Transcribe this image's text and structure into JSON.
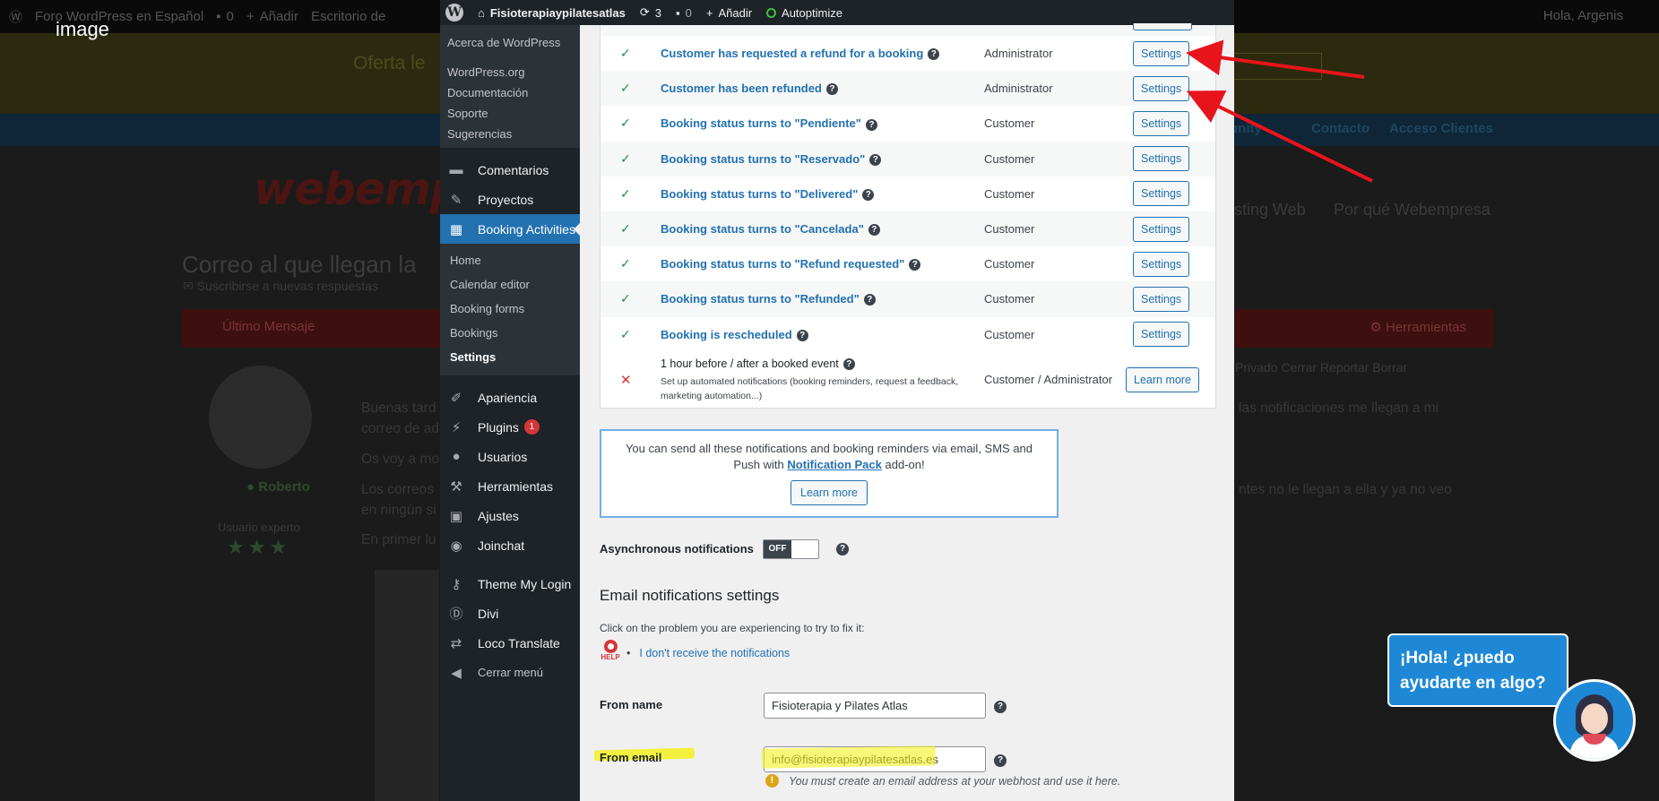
{
  "image_label": "image",
  "background": {
    "adminbar": {
      "site": "Foro WordPress en Español",
      "comments": "0",
      "add": "Añadir",
      "dashboard": "Escritorio de",
      "greeting": "Hola, Argenis"
    },
    "offer_text": "Oferta le",
    "nav": [
      "unity",
      "Contacto",
      "Acceso Clientes"
    ],
    "logo": "webempre",
    "menu": [
      "sting Web",
      "Por qué Webempresa"
    ],
    "title": "Correo al que llegan la",
    "subscribe": "Suscribirse a nuevas respuestas",
    "last_message": "Último Mensaje",
    "tools": "Herramientas",
    "post_actions": "Privado   Cerrar   Reportar   Borrar",
    "username": "Roberto",
    "user_role": "Usuario experto",
    "stars": "★★★",
    "post_lines": [
      "Buenas tard",
      "correo de ad",
      "Os voy a mo",
      "Los correos",
      "en ningún si",
      "En primer lu"
    ],
    "post_right_lines": [
      "las notificaciones me llegan a mi",
      "ntes no le llegan a ella y ya no veo"
    ]
  },
  "wp": {
    "topbar": {
      "site_name": "Fisioterapiaypilatesatlas",
      "updates": "3",
      "comments": "0",
      "add": "Añadir",
      "plugin": "Autoptimize"
    },
    "flyout": [
      "Acerca de WordPress",
      "WordPress.org",
      "Documentación",
      "Soporte",
      "Sugerencias"
    ],
    "menu_top": [
      {
        "label": "Comentarios",
        "icon": "comment-icon"
      },
      {
        "label": "Proyectos",
        "icon": "pin-icon"
      },
      {
        "label": "Booking Activities",
        "icon": "calendar-icon"
      }
    ],
    "submenu": [
      "Home",
      "Calendar editor",
      "Booking forms",
      "Bookings",
      "Settings"
    ],
    "menu_bottom": [
      {
        "label": "Apariencia",
        "icon": "brush-icon"
      },
      {
        "label": "Plugins",
        "icon": "plug-icon",
        "badge": "1"
      },
      {
        "label": "Usuarios",
        "icon": "user-icon"
      },
      {
        "label": "Herramientas",
        "icon": "wrench-icon"
      },
      {
        "label": "Ajustes",
        "icon": "settings-icon"
      },
      {
        "label": "Joinchat",
        "icon": "whatsapp-icon"
      }
    ],
    "menu_extra": [
      {
        "label": "Theme My Login",
        "icon": "key-icon"
      },
      {
        "label": "Divi",
        "icon": "divi-icon"
      },
      {
        "label": "Loco Translate",
        "icon": "translate-icon"
      },
      {
        "label": "Cerrar menú",
        "icon": "collapse-icon"
      }
    ],
    "notifications": [
      {
        "name": "Customer has requested a refund for a booking",
        "recipient": "Administrator",
        "action": "Settings"
      },
      {
        "name": "Customer has been refunded",
        "recipient": "Administrator",
        "action": "Settings"
      },
      {
        "name": "Booking status turns to \"Pendiente\"",
        "recipient": "Customer",
        "action": "Settings"
      },
      {
        "name": "Booking status turns to \"Reservado\"",
        "recipient": "Customer",
        "action": "Settings"
      },
      {
        "name": "Booking status turns to \"Delivered\"",
        "recipient": "Customer",
        "action": "Settings"
      },
      {
        "name": "Booking status turns to \"Cancelada\"",
        "recipient": "Customer",
        "action": "Settings"
      },
      {
        "name": "Booking status turns to \"Refund requested\"",
        "recipient": "Customer",
        "action": "Settings"
      },
      {
        "name": "Booking status turns to \"Refunded\"",
        "recipient": "Customer",
        "action": "Settings"
      },
      {
        "name": "Booking is rescheduled",
        "recipient": "Customer",
        "action": "Settings"
      }
    ],
    "cron_row": {
      "name": "1 hour before / after a booked event",
      "desc": "Set up automated notifications (booking reminders, request a feedback, marketing automation...)",
      "recipient": "Customer / Administrator",
      "action": "Learn more"
    },
    "pack_box": {
      "text_before": "You can send all these notifications and booking reminders via email, SMS and Push with",
      "link": "Notification Pack",
      "text_after": "add-on!",
      "button": "Learn more"
    },
    "async_label": "Asynchronous notifications",
    "async_state": "OFF",
    "email_heading": "Email notifications settings",
    "problem_text": "Click on the problem you are experiencing to try to fix it:",
    "help_label": "HELP",
    "problem_link": "I don't receive the notifications",
    "from_name_label": "From name",
    "from_name_value": "Fisioterapia y Pilates Atlas",
    "from_email_label": "From email",
    "from_email_value": "info@fisioterapiaypilatesatlas.es",
    "warning": "You must create an email address at your webhost and use it here."
  },
  "chat": {
    "bubble_line1": "¡Hola! ¿puedo",
    "bubble_line2": "ayudarte en algo?"
  },
  "colors": {
    "wp_admin_dark": "#1d2327",
    "wp_blue": "#2271b1",
    "highlight": "#f5f11f",
    "arrow": "#e8141b",
    "chat_blue": "#1e88d6"
  }
}
